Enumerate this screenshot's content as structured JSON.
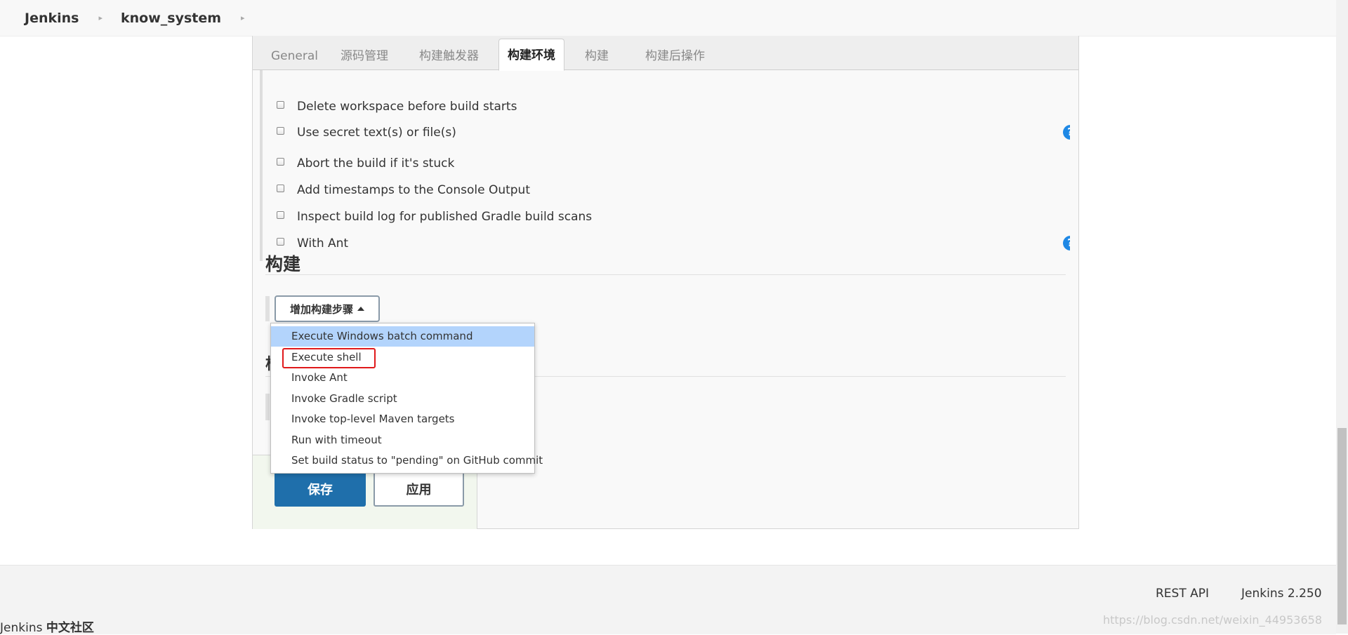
{
  "breadcrumb": {
    "items": [
      "Jenkins",
      "know_system"
    ],
    "separator": "▸"
  },
  "tabs": [
    {
      "label": "General",
      "active": false
    },
    {
      "label": "源码管理",
      "active": false
    },
    {
      "label": "构建触发器",
      "active": false
    },
    {
      "label": "构建环境",
      "active": true
    },
    {
      "label": "构建",
      "active": false
    },
    {
      "label": "构建后操作",
      "active": false
    }
  ],
  "build_env": {
    "options": [
      "Delete workspace before build starts",
      "Use secret text(s) or file(s)",
      "Abort the build if it's stuck",
      "Add timestamps to the Console Output",
      "Inspect build log for published Gradle build scans",
      "With Ant"
    ],
    "help_glyph": "?"
  },
  "build_section": {
    "title": "构建",
    "add_step_label": "增加构建步骤",
    "peek_char": "构"
  },
  "dropdown": {
    "items": [
      "Execute Windows batch command",
      "Execute shell",
      "Invoke Ant",
      "Invoke Gradle script",
      "Invoke top-level Maven targets",
      "Run with timeout",
      "Set build status to \"pending\" on GitHub commit"
    ],
    "highlighted_index": 0,
    "annotated_index": 1
  },
  "actions": {
    "save": "保存",
    "apply": "应用"
  },
  "footer": {
    "rest_api": "REST API",
    "version": "Jenkins 2.250",
    "brand_prefix": "Jenkins",
    "brand_suffix": "中文社区",
    "watermark": "https://blog.csdn.net/weixin_44953658"
  },
  "colors": {
    "primary_button": "#1f6fab",
    "help_icon": "#1e88e5",
    "highlight": "#b3d4fc",
    "annotation_red": "#e0191b"
  }
}
